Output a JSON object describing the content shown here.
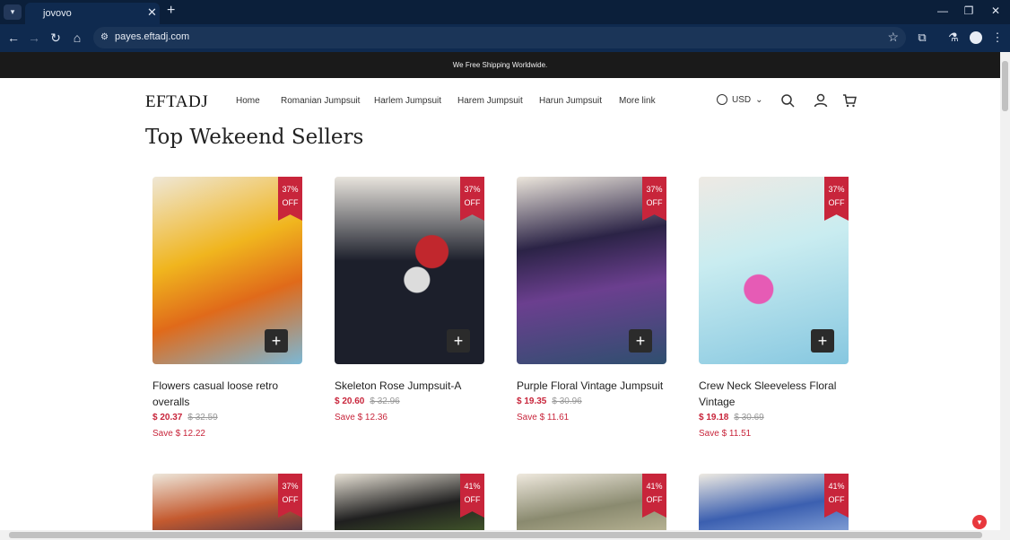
{
  "browser": {
    "tab_title": "jovovo",
    "url": "payes.eftadj.com"
  },
  "store": {
    "announcement": "We Free Shipping Worldwide.",
    "logo": "EFTADJ",
    "menu": [
      "Home",
      "Romanian Jumpsuit",
      "Harlem Jumpsuit",
      "Harem Jumpsuit",
      "Harun Jumpsuit",
      "More link"
    ],
    "currency": "USD"
  },
  "section_title": "Top Wekeend Sellers",
  "products": [
    {
      "name": "Flowers casual loose retro overalls",
      "price": "$ 20.37",
      "old_price": "$ 32.59",
      "save": "Save $ 12.22",
      "discount_pct": "37%",
      "discount_word": "OFF",
      "colors": [
        "#f0b51e",
        "#e06a1a",
        "#7bb8d6"
      ]
    },
    {
      "name": "Skeleton Rose Jumpsuit-A",
      "price": "$ 20.60",
      "old_price": "$ 32.96",
      "save": "Save $ 12.36",
      "discount_pct": "37%",
      "discount_word": "OFF",
      "colors": [
        "#1c1f2b",
        "#c1272d",
        "#dcdcdc"
      ]
    },
    {
      "name": "Purple Floral Vintage Jumpsuit",
      "price": "$ 19.35",
      "old_price": "$ 30.96",
      "save": "Save $ 11.61",
      "discount_pct": "37%",
      "discount_word": "OFF",
      "colors": [
        "#2b2346",
        "#6b3f8f",
        "#2f4f6f"
      ]
    },
    {
      "name": "Crew Neck Sleeveless Floral Vintage",
      "price": "$ 19.18",
      "old_price": "$ 30.69",
      "save": "Save $ 11.51",
      "discount_pct": "37%",
      "discount_word": "OFF",
      "colors": [
        "#c9ecf0",
        "#e65bb5",
        "#86c7e0"
      ]
    }
  ],
  "second_row": [
    {
      "discount_pct": "37%",
      "discount_word": "OFF",
      "colors": [
        "#c45a2f",
        "#2b2a4a"
      ]
    },
    {
      "discount_pct": "41%",
      "discount_word": "OFF",
      "colors": [
        "#1f1f1f",
        "#4f6b2f"
      ]
    },
    {
      "discount_pct": "41%",
      "discount_word": "OFF",
      "colors": [
        "#8a8a6f",
        "#c9c3a2"
      ]
    },
    {
      "discount_pct": "41%",
      "discount_word": "OFF",
      "colors": [
        "#3b5fb0",
        "#9bb6e3"
      ]
    }
  ]
}
